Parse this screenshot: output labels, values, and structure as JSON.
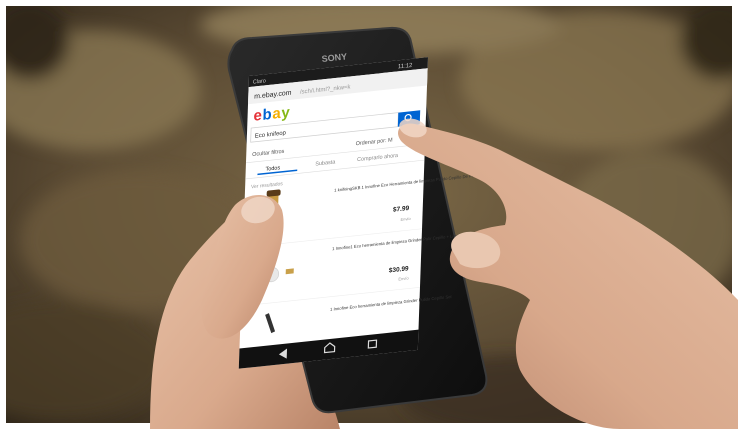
{
  "phone": {
    "brand": "SONY",
    "status_time": "11:12",
    "carrier": "Claro"
  },
  "browser": {
    "url_prefix": "m.ebay.com",
    "url_rest": "/sch/i.html?_nkw=k"
  },
  "ebay": {
    "logo": "ebay",
    "search_value": "Eco knifeop",
    "filter_label": "Ocultar filtros",
    "sort_label": "Ordenar por: M",
    "tabs": [
      "Todos",
      "Subasta",
      "Comprarlo ahora"
    ],
    "results_header": "Ver resultados",
    "listings": [
      {
        "title": "1 knifeingSKB 1 Innofine Eco Herramienta de limpieza Pulido Cepillo De Pelo",
        "price": "$7.99",
        "meta": "Envío"
      },
      {
        "title": "1 Innofine1 Eco herramienta de limpieza Grinder Pulir Cepillo + Limpieza De Pelos Brush Set",
        "price": "$30.99",
        "meta": "Envío"
      },
      {
        "title": "1 Innofine Eco herramienta de limpieza Grinder Pulido Cepillo Set"
      }
    ]
  },
  "colors": {
    "ebay_red": "#e53238",
    "ebay_blue": "#0064d2",
    "ebay_yellow": "#f5af02",
    "ebay_green": "#86b817"
  }
}
